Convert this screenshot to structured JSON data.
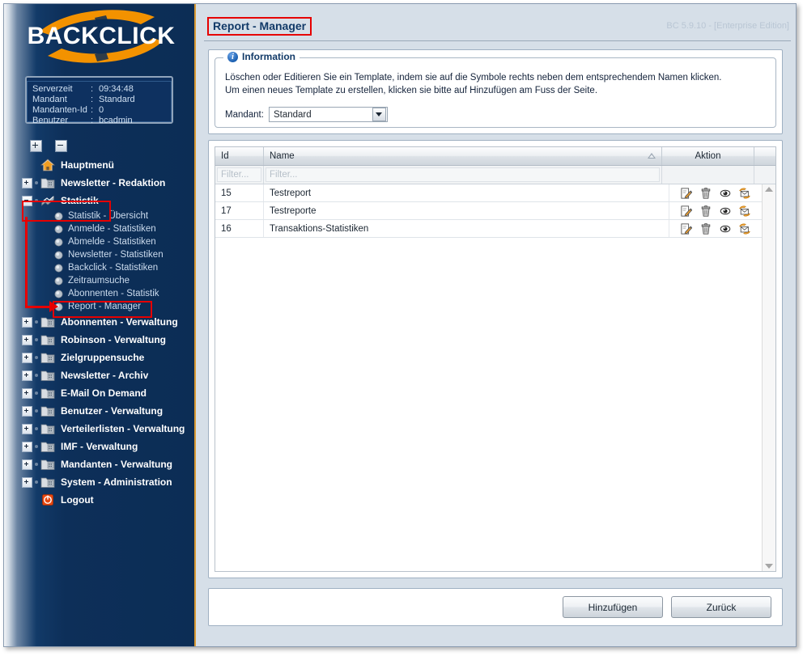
{
  "window": {
    "version_text": "BC 5.9.10 - [Enterprise Edition]",
    "page_title": "Report - Manager"
  },
  "sidebar": {
    "logo_text": "BACKCLICK",
    "status": {
      "rows": [
        {
          "label": "Serverzeit",
          "value": "09:34:48"
        },
        {
          "label": "Mandant",
          "value": "Standard"
        },
        {
          "label": "Mandanten-Id",
          "value": "0"
        },
        {
          "label": "Benutzer",
          "value": "bcadmin"
        }
      ],
      "colon": ":"
    },
    "tree_buttons": {
      "expand_all": "expand-all-icon",
      "collapse_all": "collapse-all-icon"
    },
    "items": [
      {
        "label": "Hauptmenü",
        "icon": "home-icon",
        "toggle": "none",
        "expanded": false
      },
      {
        "label": "Newsletter - Redaktion",
        "icon": "folder-icon",
        "toggle": "plus",
        "expanded": false
      },
      {
        "label": "Statistik",
        "icon": "stats-icon",
        "toggle": "minus",
        "expanded": true,
        "children": [
          {
            "label": "Statistik - Übersicht"
          },
          {
            "label": "Anmelde - Statistiken"
          },
          {
            "label": "Abmelde - Statistiken"
          },
          {
            "label": "Newsletter - Statistiken"
          },
          {
            "label": "Backclick - Statistiken"
          },
          {
            "label": "Zeitraumsuche"
          },
          {
            "label": "Abonnenten - Statistik"
          },
          {
            "label": "Report - Manager"
          }
        ]
      },
      {
        "label": "Abonnenten - Verwaltung",
        "icon": "folder-icon",
        "toggle": "plus",
        "expanded": false
      },
      {
        "label": "Robinson - Verwaltung",
        "icon": "folder-icon",
        "toggle": "plus",
        "expanded": false
      },
      {
        "label": "Zielgruppensuche",
        "icon": "folder-icon",
        "toggle": "plus",
        "expanded": false
      },
      {
        "label": "Newsletter - Archiv",
        "icon": "folder-icon",
        "toggle": "plus",
        "expanded": false
      },
      {
        "label": "E-Mail On Demand",
        "icon": "folder-icon",
        "toggle": "plus",
        "expanded": false
      },
      {
        "label": "Benutzer - Verwaltung",
        "icon": "folder-icon",
        "toggle": "plus",
        "expanded": false
      },
      {
        "label": "Verteilerlisten - Verwaltung",
        "icon": "folder-icon",
        "toggle": "plus",
        "expanded": false
      },
      {
        "label": "IMF - Verwaltung",
        "icon": "folder-icon",
        "toggle": "plus",
        "expanded": false
      },
      {
        "label": "Mandanten - Verwaltung",
        "icon": "folder-icon",
        "toggle": "plus",
        "expanded": false
      },
      {
        "label": "System - Administration",
        "icon": "folder-icon",
        "toggle": "plus",
        "expanded": false
      },
      {
        "label": "Logout",
        "icon": "logout-icon",
        "toggle": "none",
        "expanded": false
      }
    ]
  },
  "information_panel": {
    "legend": "Information",
    "legend_icon": "info-icon",
    "line1": "Löschen oder Editieren Sie ein Template, indem sie auf die Symbole rechts neben dem entsprechendem Namen klicken.",
    "line2": "Um einen neues Template zu erstellen, klicken sie bitte auf Hinzufügen am Fuss der Seite.",
    "mandant_label": "Mandant:",
    "mandant_value": "Standard"
  },
  "table": {
    "columns": [
      {
        "key": "id",
        "label": "Id",
        "sorted": false
      },
      {
        "key": "name",
        "label": "Name",
        "sorted": true,
        "sort_dir": "asc"
      },
      {
        "key": "aktion",
        "label": "Aktion",
        "sorted": false
      }
    ],
    "filters": {
      "id_placeholder": "Filter...",
      "name_placeholder": "Filter..."
    },
    "rows": [
      {
        "id": "15",
        "name": "Testreport"
      },
      {
        "id": "17",
        "name": "Testreporte"
      },
      {
        "id": "16",
        "name": "Transaktions-Statistiken"
      }
    ],
    "action_icons": [
      "edit-icon",
      "delete-icon",
      "preview-icon",
      "send-mail-icon"
    ]
  },
  "footer": {
    "add_button": "Hinzufügen",
    "back_button": "Zurück"
  },
  "annotations": {
    "highlight_color": "#e60000",
    "boxes": [
      "page-title",
      "sidebar-item-statistik",
      "sidebar-subitem-report-manager"
    ],
    "arrow": "points from Statistik down to Report - Manager"
  },
  "colors": {
    "sidebar_dark": "#0c2d55",
    "accent_orange": "#f39200",
    "title_blue": "#123a68",
    "page_bg": "#d6dfe8",
    "highlight_red": "#e60000"
  }
}
